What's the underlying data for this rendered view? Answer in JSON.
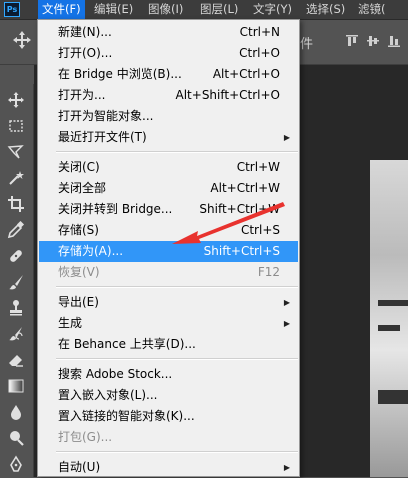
{
  "app": {
    "logo": "Ps"
  },
  "menubar": {
    "items": [
      {
        "label": "文件(F)"
      },
      {
        "label": "编辑(E)"
      },
      {
        "label": "图像(I)"
      },
      {
        "label": "图层(L)"
      },
      {
        "label": "文字(Y)"
      },
      {
        "label": "选择(S)"
      },
      {
        "label": "滤镜("
      }
    ]
  },
  "optionsbar": {
    "partial_text": "件"
  },
  "file_menu": {
    "items": [
      {
        "label": "新建(N)...",
        "shortcut": "Ctrl+N"
      },
      {
        "label": "打开(O)...",
        "shortcut": "Ctrl+O"
      },
      {
        "label": "在 Bridge 中浏览(B)...",
        "shortcut": "Alt+Ctrl+O"
      },
      {
        "label": "打开为...",
        "shortcut": "Alt+Shift+Ctrl+O"
      },
      {
        "label": "打开为智能对象...",
        "shortcut": ""
      },
      {
        "label": "最近打开文件(T)",
        "shortcut": "",
        "submenu": true
      },
      {
        "label": "关闭(C)",
        "shortcut": "Ctrl+W"
      },
      {
        "label": "关闭全部",
        "shortcut": "Alt+Ctrl+W"
      },
      {
        "label": "关闭并转到 Bridge...",
        "shortcut": "Shift+Ctrl+W"
      },
      {
        "label": "存储(S)",
        "shortcut": "Ctrl+S"
      },
      {
        "label": "存储为(A)...",
        "shortcut": "Shift+Ctrl+S",
        "highlighted": true
      },
      {
        "label": "恢复(V)",
        "shortcut": "F12",
        "disabled": true
      },
      {
        "label": "导出(E)",
        "shortcut": "",
        "submenu": true
      },
      {
        "label": "生成",
        "shortcut": "",
        "submenu": true
      },
      {
        "label": "在 Behance 上共享(D)...",
        "shortcut": ""
      },
      {
        "label": "搜索 Adobe Stock...",
        "shortcut": ""
      },
      {
        "label": "置入嵌入对象(L)...",
        "shortcut": ""
      },
      {
        "label": "置入链接的智能对象(K)...",
        "shortcut": ""
      },
      {
        "label": "打包(G)...",
        "shortcut": "",
        "disabled": true
      },
      {
        "label": "自动(U)",
        "shortcut": "",
        "submenu": true
      }
    ],
    "submenu_glyph": "▶"
  },
  "toolbar": {
    "tools": [
      {
        "icon": "move-icon"
      },
      {
        "icon": "marquee-icon"
      },
      {
        "icon": "lasso-icon"
      },
      {
        "icon": "magic-wand-icon"
      },
      {
        "icon": "crop-icon"
      },
      {
        "icon": "eyedropper-icon"
      },
      {
        "icon": "healing-brush-icon"
      },
      {
        "icon": "brush-icon"
      },
      {
        "icon": "clone-stamp-icon"
      },
      {
        "icon": "history-brush-icon"
      },
      {
        "icon": "eraser-icon"
      },
      {
        "icon": "gradient-icon"
      },
      {
        "icon": "blur-icon"
      },
      {
        "icon": "dodge-icon"
      },
      {
        "icon": "pen-icon"
      }
    ]
  },
  "colors": {
    "menu_highlight": "#3196f8",
    "menubar_active": "#1473e6",
    "annotation_arrow": "#e8322e"
  }
}
